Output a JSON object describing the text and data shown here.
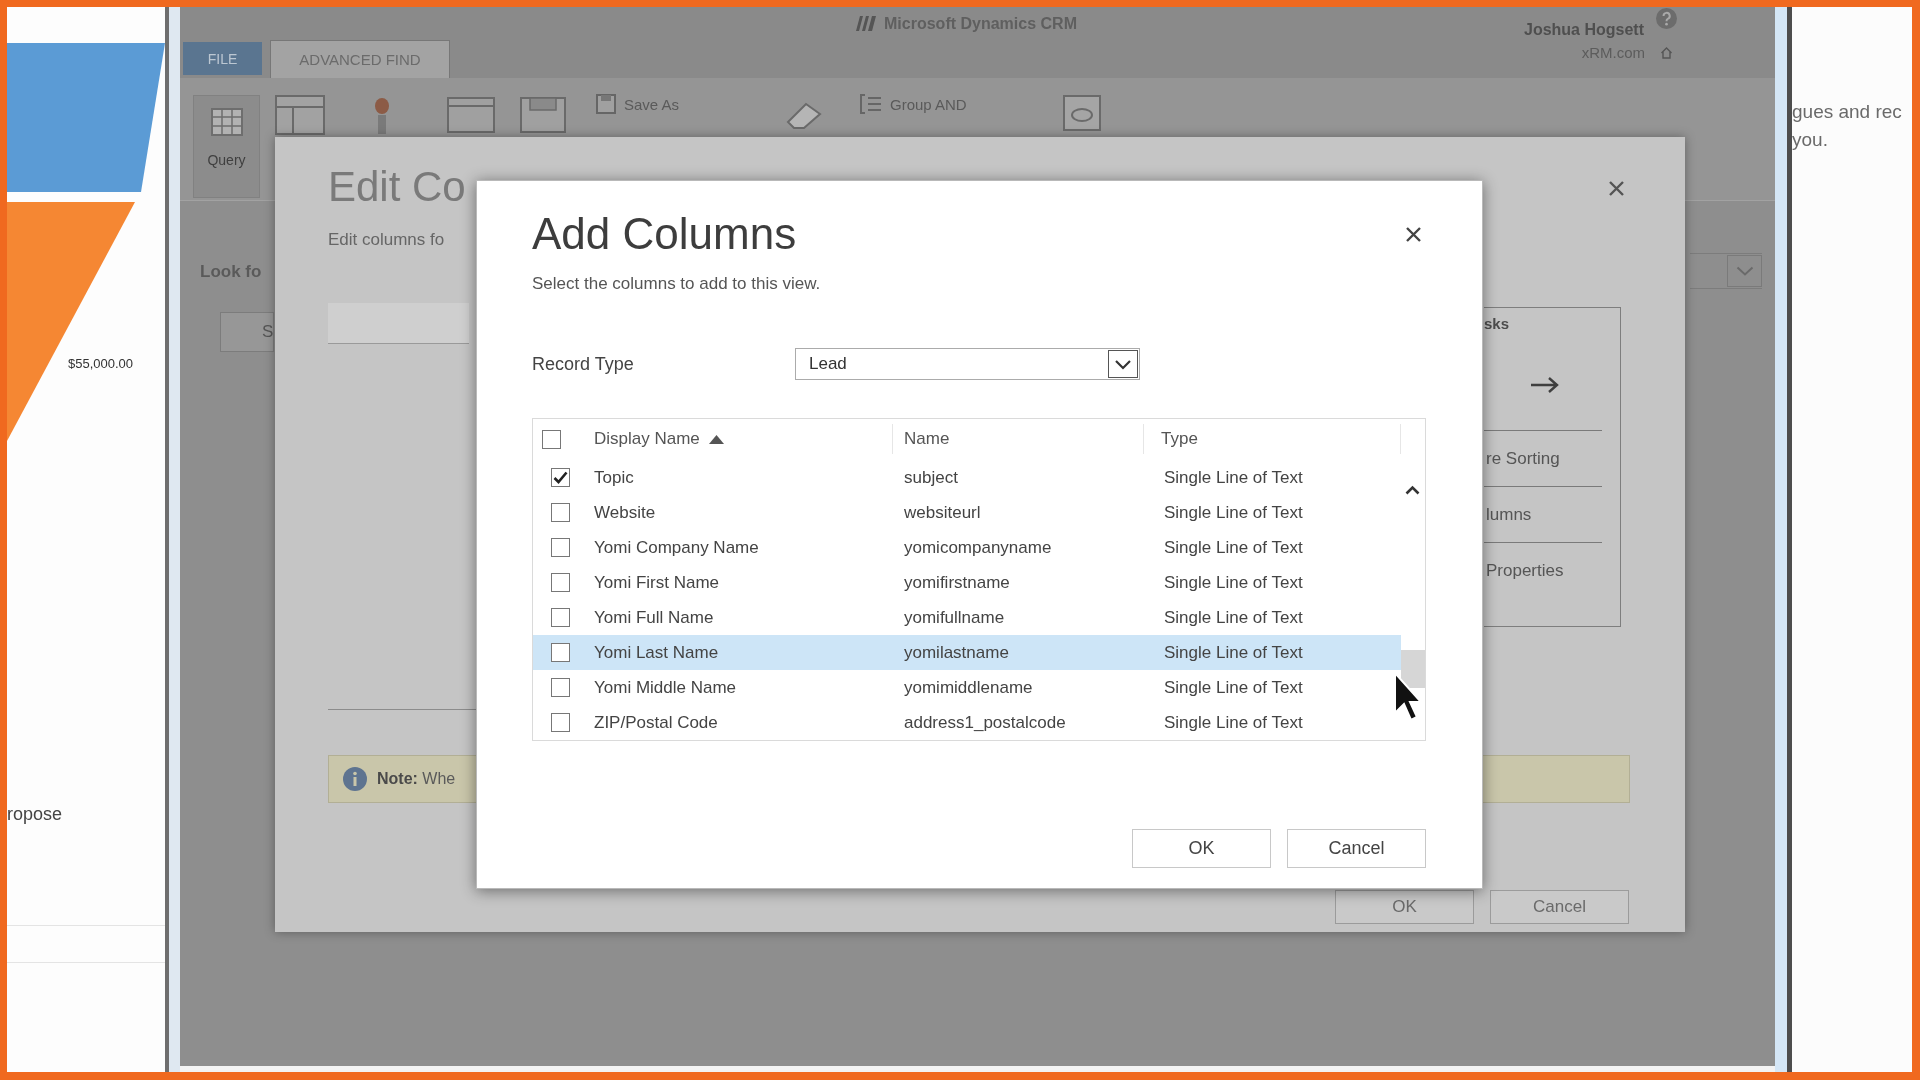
{
  "side_panel": {
    "chart_value_label": "$55,000.00",
    "text_fragment": "ropose"
  },
  "app_header": {
    "product_name": "Microsoft Dynamics CRM",
    "user_name": "Joshua Hogsett",
    "organization": "xRM.com"
  },
  "ribbon_tabs": [
    {
      "label": "FILE",
      "kind": "file",
      "selected": false
    },
    {
      "label": "ADVANCED FIND",
      "kind": "tab",
      "selected": true
    }
  ],
  "ribbon": {
    "query_label": "Query",
    "save_as_label": "Save As",
    "group_and_label": "Group AND"
  },
  "advanced_find": {
    "look_for_label": "Look fo",
    "search_value": "S"
  },
  "edit_columns_dialog": {
    "title": "Edit Co",
    "subtitle": "Edit columns fo",
    "common_tasks": {
      "heading": "sks",
      "items": [
        "re Sorting",
        "lumns",
        "Properties"
      ]
    },
    "note": "**Note:** Whe",
    "buttons": [
      "OK",
      "Cancel"
    ]
  },
  "add_columns_dialog": {
    "title": "Add Columns",
    "subtitle": "Select the columns to add to this view.",
    "record_type": {
      "label": "Record Type",
      "value": "Lead"
    },
    "table": {
      "select_all_checked": false,
      "columns": [
        {
          "label": "Display Name",
          "sort_ascending": true
        },
        {
          "label": "Name",
          "sort_ascending": false
        },
        {
          "label": "Type",
          "sort_ascending": false
        }
      ],
      "rows": [
        {
          "display_name": "Topic",
          "name": "subject",
          "type": "Single Line of Text",
          "checked": true,
          "selected": false
        },
        {
          "display_name": "Website",
          "name": "websiteurl",
          "type": "Single Line of Text",
          "checked": false,
          "selected": false
        },
        {
          "display_name": "Yomi Company Name",
          "name": "yomicompanyname",
          "type": "Single Line of Text",
          "checked": false,
          "selected": false
        },
        {
          "display_name": "Yomi First Name",
          "name": "yomifirstname",
          "type": "Single Line of Text",
          "checked": false,
          "selected": false
        },
        {
          "display_name": "Yomi Full Name",
          "name": "yomifullname",
          "type": "Single Line of Text",
          "checked": false,
          "selected": false
        },
        {
          "display_name": "Yomi Last Name",
          "name": "yomilastname",
          "type": "Single Line of Text",
          "checked": false,
          "selected": true
        },
        {
          "display_name": "Yomi Middle Name",
          "name": "yomimiddlename",
          "type": "Single Line of Text",
          "checked": false,
          "selected": false
        },
        {
          "display_name": "ZIP/Postal Code",
          "name": "address1_postalcode",
          "type": "Single Line of Text",
          "checked": false,
          "selected": false
        }
      ]
    },
    "buttons": [
      "OK",
      "Cancel"
    ]
  },
  "right_panel": {
    "lines": [
      "gues and rec",
      "you."
    ]
  }
}
